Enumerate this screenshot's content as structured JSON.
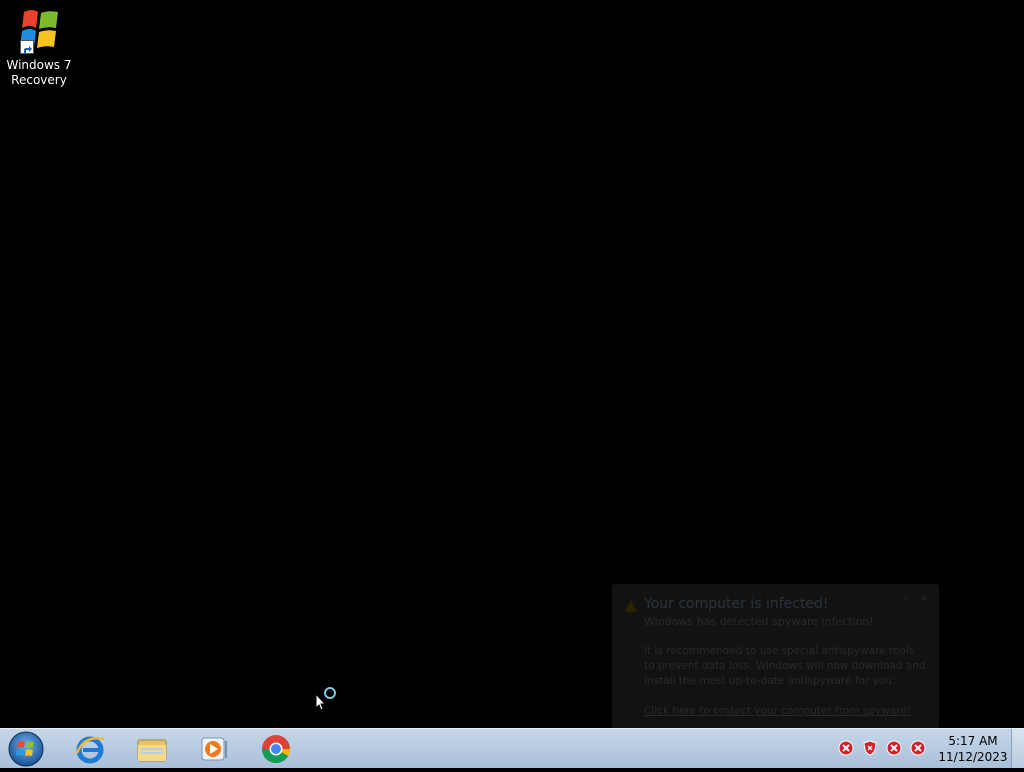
{
  "desktop": {
    "icons": [
      {
        "label": "Windows 7 Recovery",
        "icon": "windows-flag-icon"
      }
    ]
  },
  "popup": {
    "title": "Your computer is infected!",
    "subtitle": "Windows has detected spyware infection!",
    "body": "It is recommended to use special antispyware tools to prevent data loss. Windows will now download and install the most up-to-date antispyware for you.",
    "link": "Click here to protect your computer from spyware!",
    "icon": "warning-icon"
  },
  "taskbar": {
    "start": "start-orb-icon",
    "pinned": [
      {
        "name": "Internet Explorer",
        "icon": "ie-icon"
      },
      {
        "name": "Windows Explorer",
        "icon": "folder-icon"
      },
      {
        "name": "Windows Media Player",
        "icon": "media-player-icon"
      },
      {
        "name": "Google Chrome",
        "icon": "chrome-icon"
      }
    ],
    "tray_icons": [
      "error-icon",
      "shield-alert-icon",
      "error-icon",
      "error-icon"
    ],
    "clock": {
      "time": "5:17 AM",
      "date": "11/12/2023"
    }
  },
  "colors": {
    "desktop_bg": "#000000",
    "taskbar_top": "#c6d6e8",
    "taskbar_bottom": "#a9c0d9",
    "alert_red": "#d2202a"
  }
}
